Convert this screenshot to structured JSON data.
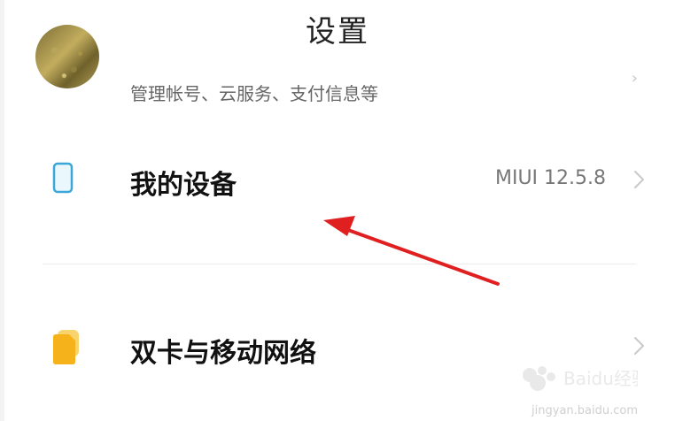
{
  "header": {
    "title": "设置"
  },
  "account": {
    "subtitle": "管理帐号、云服务、支付信息等"
  },
  "device": {
    "label": "我的设备",
    "version": "MIUI 12.5.8",
    "icon": "phone-icon"
  },
  "sim": {
    "label": "双卡与移动网络",
    "icon": "sim-card-icon"
  },
  "overlay": {
    "arrow_color": "#e02020"
  },
  "watermark": {
    "brand": "Baidu经验",
    "url": "jingyan.baidu.com"
  },
  "colors": {
    "phone_icon": "#3ba7d8",
    "sim_icon": "#f5b21a",
    "chevron": "#c9c9c9"
  }
}
